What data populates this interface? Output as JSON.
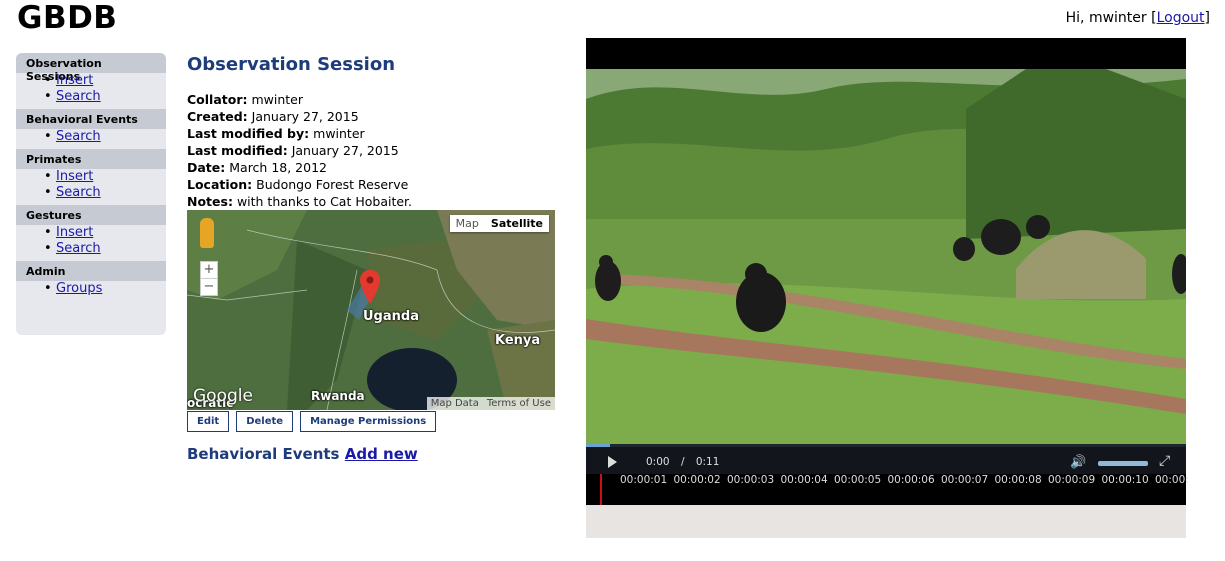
{
  "app": {
    "logo": "GBDB"
  },
  "userbar": {
    "greeting": "Hi, mwinter [",
    "logout": "Logout",
    "close": "]"
  },
  "sidebar": {
    "groups": [
      {
        "heading": "Observation Sessions",
        "items": [
          "Insert",
          "Search"
        ]
      },
      {
        "heading": "Behavioral Events",
        "items": [
          "Search"
        ]
      },
      {
        "heading": "Primates",
        "items": [
          "Insert",
          "Search"
        ]
      },
      {
        "heading": "Gestures",
        "items": [
          "Insert",
          "Search"
        ]
      },
      {
        "heading": "Admin",
        "items": [
          "Groups"
        ]
      }
    ]
  },
  "session": {
    "title": "Observation Session",
    "fields": [
      {
        "label": "Collator:",
        "value": "mwinter"
      },
      {
        "label": "Created:",
        "value": "January 27, 2015"
      },
      {
        "label": "Last modified by:",
        "value": "mwinter"
      },
      {
        "label": "Last modified:",
        "value": "January 27, 2015"
      },
      {
        "label": "Date:",
        "value": "March 18, 2012"
      },
      {
        "label": "Location:",
        "value": "Budongo Forest Reserve"
      },
      {
        "label": "Notes:",
        "value": "with thanks to Cat Hobaiter."
      }
    ]
  },
  "map": {
    "toggle": {
      "map": "Map",
      "satellite": "Satellite",
      "active": "satellite"
    },
    "zoom_in": "+",
    "zoom_out": "−",
    "labels": {
      "uganda": "Uganda",
      "kenya": "Kenya",
      "rwanda": "Rwanda",
      "edge": "ocratic"
    },
    "brand": "Google",
    "credits": {
      "data": "Map Data",
      "terms": "Terms of Use"
    }
  },
  "actions": {
    "edit": "Edit",
    "delete": "Delete",
    "permissions": "Manage Permissions"
  },
  "events": {
    "heading": "Behavioral Events",
    "add_new": "Add new"
  },
  "video": {
    "current_time": "0:00",
    "separator": "/",
    "duration": "0:11",
    "progress_fraction": 0.04,
    "timeline_labels": [
      "00:00:01",
      "00:00:02",
      "00:00:03",
      "00:00:04",
      "00:00:05",
      "00:00:06",
      "00:00:07",
      "00:00:08",
      "00:00:09",
      "00:00:10",
      "00:00:"
    ]
  },
  "colors": {
    "title": "#1f3c7a",
    "link": "#1a1aa6",
    "sidebar_bg": "#e6e8ee",
    "sidebar_head": "#c6cad3"
  }
}
